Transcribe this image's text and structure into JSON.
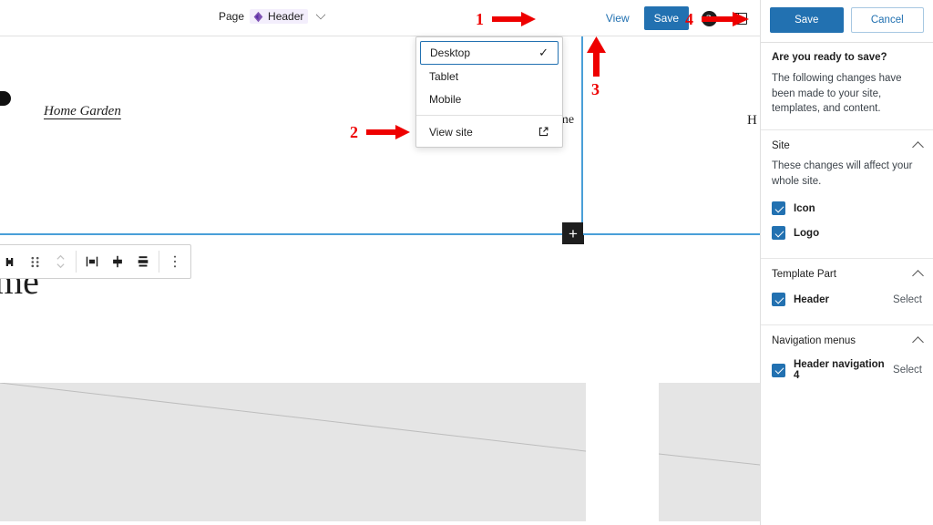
{
  "toolbar": {
    "breadcrumb_page_label": "Page",
    "breadcrumb_chip_label": "Header",
    "breadcrumb_chip_icon": "template-part-diamond-icon",
    "breadcrumb_chevron_icon": "chevron-down-icon",
    "view_label": "View",
    "save_label": "Save",
    "help_icon": "help-circle-icon",
    "help_glyph": "?",
    "sidebar_toggle_icon": "settings-sidebar-icon"
  },
  "block_toolbar": {
    "block_type_icon": "paragraph-block-icon",
    "drag_handle_icon": "drag-handle-icon",
    "movers_icon": "move-up-down-icon",
    "align_left_icon": "align-left-icon",
    "align_center_icon": "align-center-icon",
    "align_right_icon": "align-right-icon",
    "more_options_icon": "three-dots-vertical-icon"
  },
  "dropdown": {
    "items": [
      {
        "label": "Desktop",
        "selected": true,
        "check_glyph": "✓"
      },
      {
        "label": "Tablet",
        "selected": false
      },
      {
        "label": "Mobile",
        "selected": false
      }
    ],
    "view_site_label": "View site",
    "view_site_icon": "external-link-icon"
  },
  "canvas": {
    "site_logo_icon": "site-logo-icon",
    "home_garden_link": "Home Garden",
    "nav_item_partial": "ome",
    "strip_partial": "H",
    "big_heading_partial": "me",
    "add_block_glyph": "+",
    "add_block_name": "add-block-button",
    "image_placeholder_icon": "broken-image-placeholder"
  },
  "save_panel": {
    "save_label": "Save",
    "cancel_label": "Cancel",
    "question": "Are you ready to save?",
    "description": "The following changes have been made to your site, templates, and content.",
    "sections": [
      {
        "title": "Site",
        "note": "These changes will affect your whole site.",
        "rows": [
          {
            "label": "Icon",
            "checked": true,
            "action": ""
          },
          {
            "label": "Logo",
            "checked": true,
            "action": ""
          }
        ]
      },
      {
        "title": "Template Part",
        "note": "",
        "rows": [
          {
            "label": "Header",
            "checked": true,
            "action": "Select"
          }
        ]
      },
      {
        "title": "Navigation menus",
        "note": "",
        "rows": [
          {
            "label": "Header navigation 4",
            "checked": true,
            "action": "Select"
          }
        ]
      }
    ]
  },
  "annotations": [
    {
      "number": "1",
      "direction": "right"
    },
    {
      "number": "2",
      "direction": "right"
    },
    {
      "number": "3",
      "direction": "up"
    },
    {
      "number": "4",
      "direction": "right"
    }
  ],
  "colors": {
    "accent_blue": "#2271b1",
    "selection_blue": "#4a9fd8",
    "annotation_red": "#ee0000",
    "chip_purple": "#7f54b3",
    "placeholder_gray": "#e5e5e5"
  }
}
